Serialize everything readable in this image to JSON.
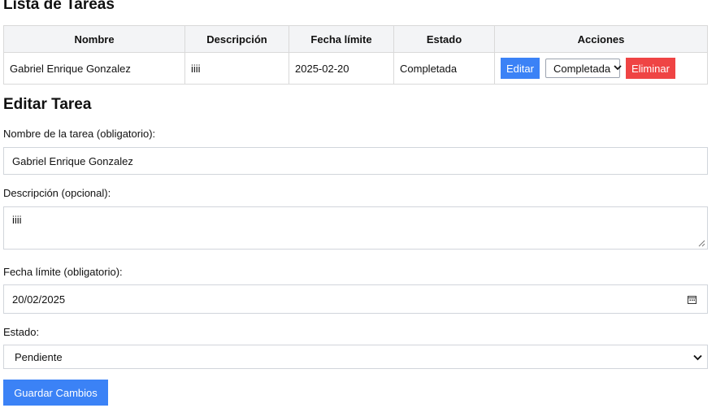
{
  "list": {
    "title": "Lista de Tareas",
    "columns": {
      "nombre": "Nombre",
      "descripcion": "Descripción",
      "fecha": "Fecha límite",
      "estado": "Estado",
      "acciones": "Acciones"
    },
    "rows": [
      {
        "nombre": "Gabriel Enrique Gonzalez",
        "descripcion": "iiii",
        "fecha": "2025-02-20",
        "estado": "Completada",
        "edit_label": "Editar",
        "status_select": "Completada",
        "delete_label": "Eliminar"
      }
    ]
  },
  "edit": {
    "title": "Editar Tarea",
    "name_label": "Nombre de la tarea (obligatorio):",
    "name_value": "Gabriel Enrique Gonzalez",
    "desc_label": "Descripción (opcional):",
    "desc_value": "iiii",
    "date_label": "Fecha límite (obligatorio):",
    "date_value": "20/02/2025",
    "status_label": "Estado:",
    "status_value": "Pendiente",
    "save_label": "Guardar Cambios"
  },
  "icons": {
    "row_status_chevron": "chevron-down-icon",
    "calendar": "calendar-icon",
    "resize": "resize-handle-icon",
    "status_chevron": "chevron-down-icon"
  },
  "colors": {
    "primary": "#3b82f6",
    "danger": "#ef4444",
    "header_bg": "#f3f4f6"
  }
}
